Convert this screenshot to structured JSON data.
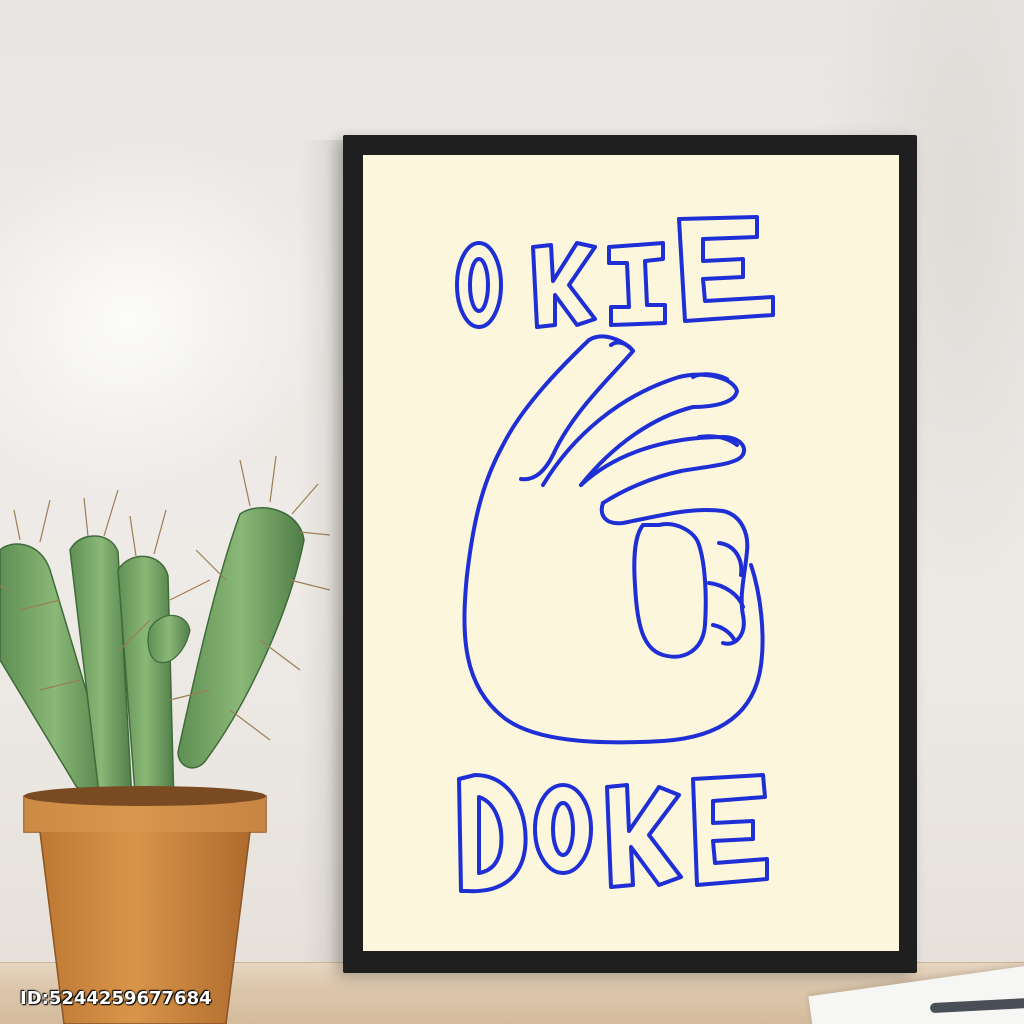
{
  "poster": {
    "line_top": "OKIE",
    "line_bottom": "DOKE",
    "ink_color": "#1f2fd6",
    "paper_color": "#fbf6dc",
    "frame_color": "#1f1f1f",
    "hand_gesture_icon": "ok-hand-icon"
  },
  "watermark": {
    "text": "ID:5244259677684"
  },
  "plant": {
    "type_icon": "cactus-icon",
    "pot_color": "#d08a3e"
  }
}
